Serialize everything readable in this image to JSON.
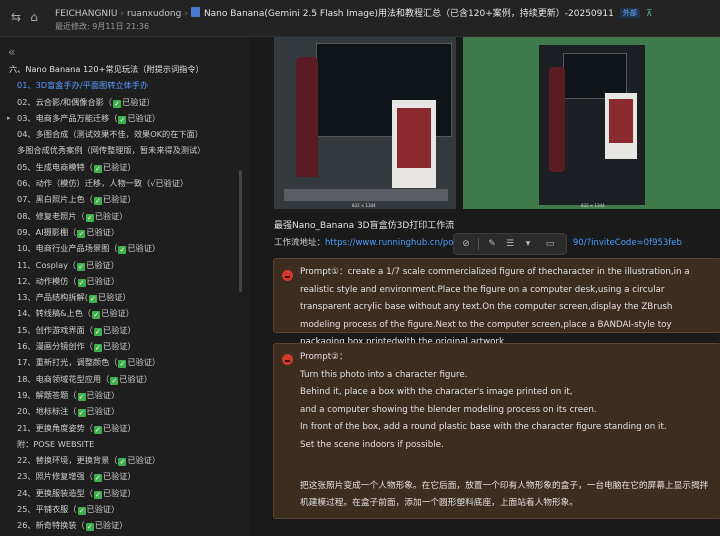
{
  "header": {
    "workspace": "FEICHANGNIU",
    "sep": "›",
    "owner": "ruanxudong",
    "title": "Nano Banana(Gemini 2.5 Flash Image)用法和教程汇总（已含120+案例，持续更新）-20250911",
    "badge": "外部",
    "updated": "最近修改: 9月11日 21:36"
  },
  "sidebar": {
    "collapse_icon": "«",
    "items": [
      {
        "text": "六、Nano Banana 120+常见玩法（附提示词指令）",
        "level": 1
      },
      {
        "text": "01、3D盲盒手办/平面图转立体手办",
        "active": true
      },
      {
        "text": "02、云合影/和偶像合影（",
        "check": true,
        "after": "已验证）"
      },
      {
        "text": "03、电商多产品万能迁移（",
        "check": true,
        "after": "已验证）",
        "arrow": true
      },
      {
        "text": "04、多图合成（测试效果不佳，效果OK的在下面）"
      },
      {
        "text": "多图合成优秀案例（网传整理版，暂未来得及测试）"
      },
      {
        "text": "05、生成电商模特（",
        "check": true,
        "after": "已验证）"
      },
      {
        "text": "06、动作（模仿）迁移，人物一致（√已验证）"
      },
      {
        "text": "07、黑白照片上色（",
        "check": true,
        "after": "已验证）"
      },
      {
        "text": "08、修复老照片（",
        "check": true,
        "after": "已验证）"
      },
      {
        "text": "09、AI摄影棚（",
        "check": true,
        "after": "已验证）"
      },
      {
        "text": "10、电商行业产品场景图（",
        "check": true,
        "after": "已验证）"
      },
      {
        "text": "11、Cosplay（",
        "check": true,
        "after": "已验证）"
      },
      {
        "text": "12、动作模仿（",
        "check": true,
        "after": "已验证）"
      },
      {
        "text": "13、产品结构拆解(",
        "check": true,
        "after": "已验证）"
      },
      {
        "text": "14、转线稿&上色（",
        "check": true,
        "after": "已验证）"
      },
      {
        "text": "15、创作游戏界面（",
        "check": true,
        "after": "已验证）"
      },
      {
        "text": "16、漫画分镜创作（",
        "check": true,
        "after": "已验证）"
      },
      {
        "text": "17、重新打光，调整颜色（",
        "check": true,
        "after": "已验证）"
      },
      {
        "text": "18、电商领域花型应用（",
        "check": true,
        "after": "已验证）"
      },
      {
        "text": "19、解题答题（",
        "check": true,
        "after": "已验证）"
      },
      {
        "text": "20、地标标注（",
        "check": true,
        "after": "已验证）"
      },
      {
        "text": "21、更换角度姿势（",
        "check": true,
        "after": "已验证）"
      },
      {
        "text": "附：POSE WEBSITE"
      },
      {
        "text": "22、替换环境，更换背景（",
        "check": true,
        "after": "已验证）"
      },
      {
        "text": "23、照片修复增强（",
        "check": true,
        "after": "已验证）"
      },
      {
        "text": "24、更换服装造型（",
        "check": true,
        "after": "已验证）"
      },
      {
        "text": "25、平铺衣服（",
        "check": true,
        "after": "已验证）"
      },
      {
        "text": "26、新奇特换装（",
        "check": true,
        "after": "已验证）"
      }
    ]
  },
  "main": {
    "heading": "最强Nano_Banana 3D盲盒仿3D打印工作流",
    "link_label": "工作流地址：",
    "link_url": "https://www.runninghub.cn/pos",
    "link_tail": "90/?inviteCode=0f953feb",
    "img_caption": "832 × 1344",
    "prompt1": "Prompt①：create a 1/7 scale commercialized figure of thecharacter in the illustration,in a realistic style and environment.Place the figure on a computer desk,using a circular transparent acrylic base without any text.On the computer screen,display the ZBrush modeling process of the figure.Next to the computer screen,place a BANDAI-style toy packaging box printedwith the original artwork.",
    "prompt2_lines": [
      "Prompt②：",
      "Turn this photo into a character figure.",
      "Behind it, place a box with the character's image printed on it,",
      "and a computer showing the blender modeling process on its creen.",
      "In front of the box, add a round plastic base with the character figure standing on it.",
      "Set the scene indoors if possible.",
      "",
      "把这张照片变成一个人物形象。在它后面，放置一个印有人物形象的盒子，一台电脑在它的屏幕上显示揭拌机建模过程。在盒子前面，添加一个圆形塑料底座，上面站着人物形象。"
    ]
  }
}
